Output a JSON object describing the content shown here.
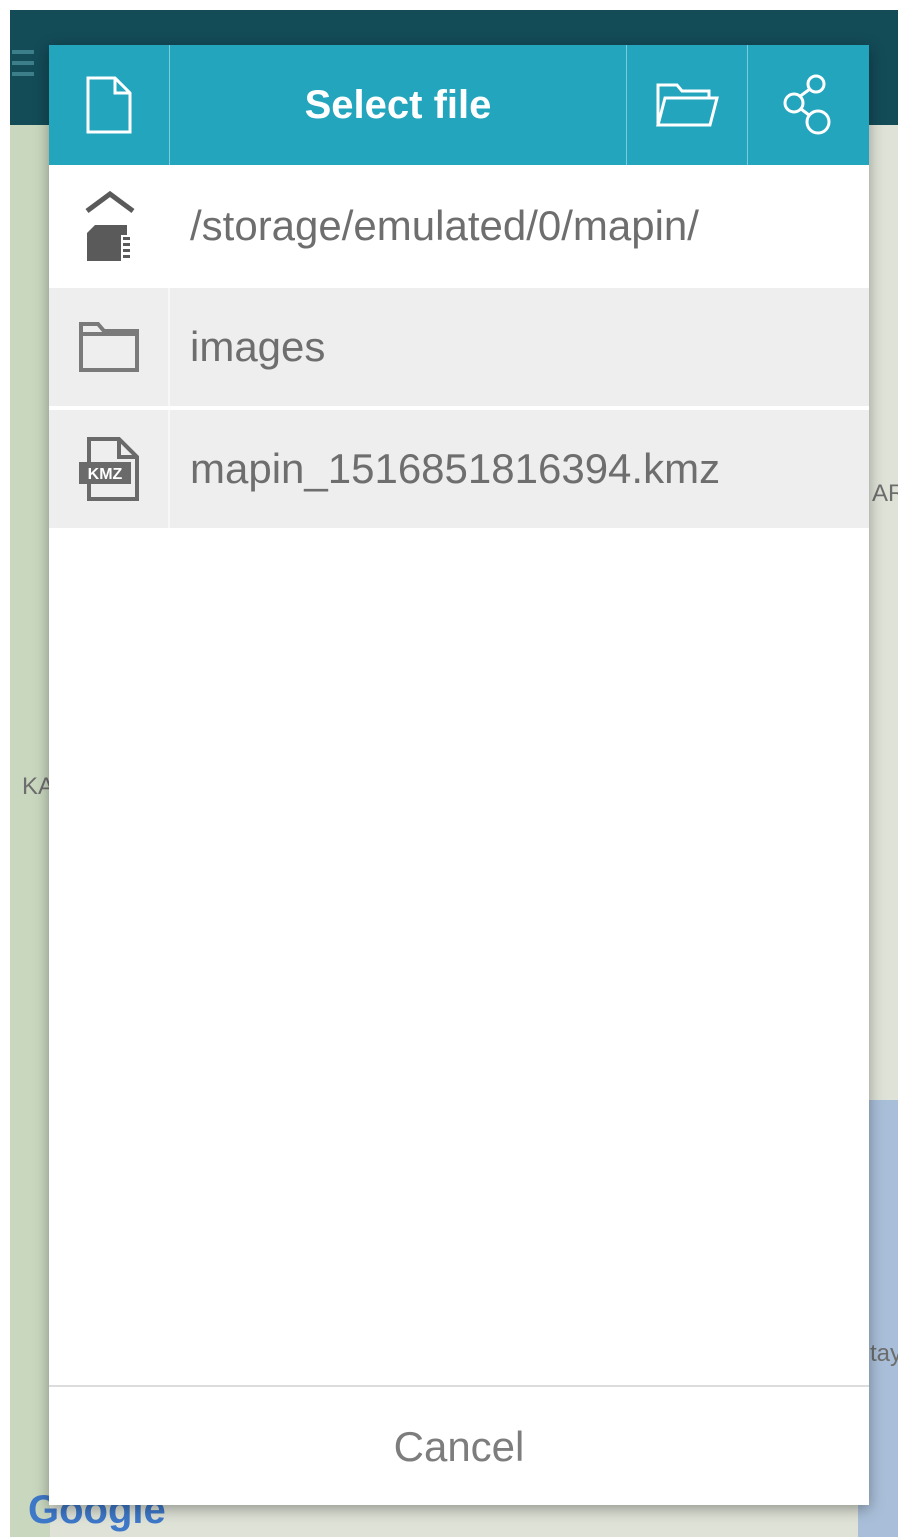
{
  "dialog": {
    "title": "Select file",
    "current_path": "/storage/emulated/0/mapin/",
    "items": [
      {
        "name": "images",
        "type": "folder",
        "icon": "folder-icon"
      },
      {
        "name": "mapin_1516851816394.kmz",
        "type": "file",
        "icon": "kmz-file-icon",
        "badge": "KMZ"
      }
    ],
    "cancel_label": "Cancel",
    "header_icons": [
      "file-icon",
      "folder-open-icon",
      "share-icon"
    ],
    "accent_color": "#22a5bd"
  },
  "background": {
    "map_labels": [
      "KA",
      "AR",
      "tay"
    ],
    "attribution": "Google"
  }
}
